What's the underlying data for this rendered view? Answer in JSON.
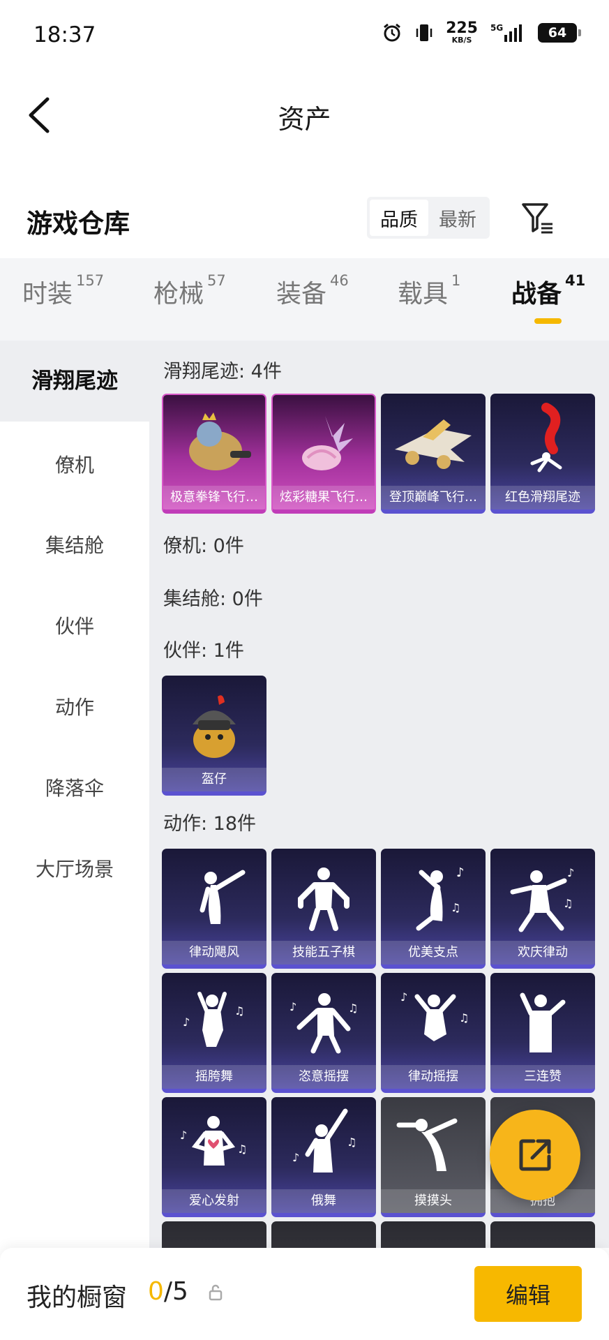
{
  "status_bar": {
    "time": "18:37",
    "net_speed": "225",
    "net_unit": "KB/S",
    "network": "5G",
    "battery": "64"
  },
  "header": {
    "title": "资产",
    "back_icon": "chevron-left-icon"
  },
  "warehouse": {
    "heading": "游戏仓库",
    "sort_options": [
      {
        "label": "品质",
        "active": true
      },
      {
        "label": "最新",
        "active": false
      }
    ],
    "filter_icon": "filter-list-icon"
  },
  "tabs": [
    {
      "label": "时装",
      "count": "157",
      "active": false
    },
    {
      "label": "枪械",
      "count": "57",
      "active": false
    },
    {
      "label": "装备",
      "count": "46",
      "active": false
    },
    {
      "label": "载具",
      "count": "1",
      "active": false
    },
    {
      "label": "战备",
      "count": "41",
      "active": true
    }
  ],
  "sidebar": {
    "items": [
      {
        "label": "滑翔尾迹",
        "active": true
      },
      {
        "label": "僚机",
        "active": false
      },
      {
        "label": "集结舱",
        "active": false
      },
      {
        "label": "伙伴",
        "active": false
      },
      {
        "label": "动作",
        "active": false
      },
      {
        "label": "降落伞",
        "active": false
      },
      {
        "label": "大厅场景",
        "active": false
      }
    ]
  },
  "sections": {
    "glide": {
      "title": "滑翔尾迹: 4件",
      "items": [
        "极意拳锋飞行…",
        "炫彩糖果飞行…",
        "登顶巅峰飞行…",
        "红色滑翔尾迹"
      ]
    },
    "wingman": {
      "title": "僚机: 0件"
    },
    "pod": {
      "title": "集结舱: 0件"
    },
    "partner": {
      "title": "伙伴: 1件",
      "items": [
        "盔仔"
      ]
    },
    "emote": {
      "title": "动作: 18件",
      "items": [
        "律动飓风",
        "技能五子棋",
        "优美支点",
        "欢庆律动",
        "摇胯舞",
        "恣意摇摆",
        "律动摇摆",
        "三连赞",
        "爱心发射",
        "俄舞",
        "摸摸头",
        "拥抱"
      ]
    }
  },
  "fab_icon": "share-external-icon",
  "bottom_bar": {
    "label": "我的橱窗",
    "count_current": "0",
    "count_sep_total": "/5",
    "lock_icon": "lock-icon",
    "edit_label": "编辑"
  },
  "colors": {
    "accent": "#f7b800",
    "card_purple": "#5b52d0",
    "card_pink": "#c03cb8"
  }
}
